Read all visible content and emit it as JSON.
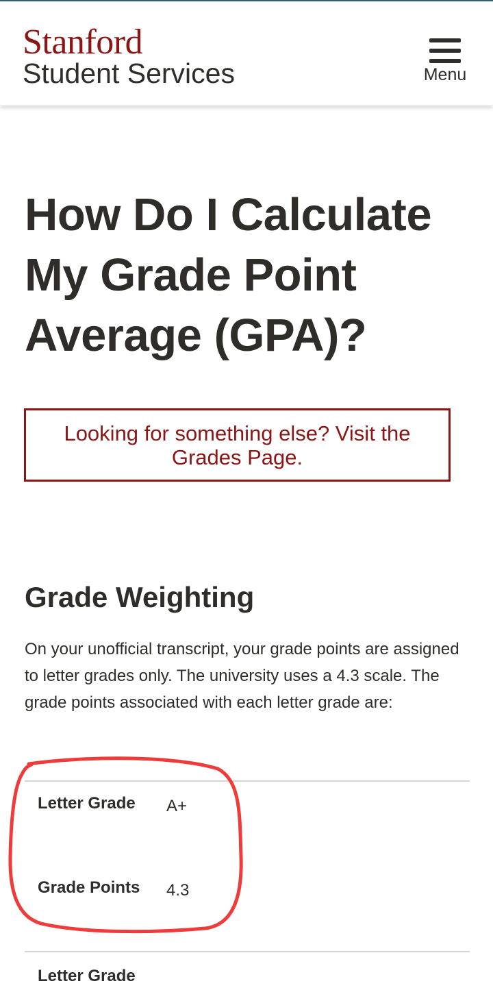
{
  "header": {
    "logo_primary": "Stanford",
    "logo_secondary": "Student Services",
    "menu_label": "Menu",
    "menu_icon": "hamburger-icon"
  },
  "page": {
    "title": "How Do I Calculate My Grade Point Average (GPA)?"
  },
  "notice": {
    "link_text": "Looking for something else? Visit the Grades Page."
  },
  "section": {
    "title": "Grade Weighting",
    "intro": "On your unofficial transcript, your grade points are assigned to letter grades only. The university uses a 4.3 scale. The grade points associated with each letter grade are:"
  },
  "grade_table": {
    "rows": [
      {
        "label": "Letter Grade",
        "value": "A+"
      },
      {
        "label": "Grade Points",
        "value": "4.3"
      }
    ]
  },
  "colors": {
    "brand_cardinal": "#8c1515",
    "text_dark": "#2e2d29",
    "annotation_red": "#ee3b3b"
  }
}
